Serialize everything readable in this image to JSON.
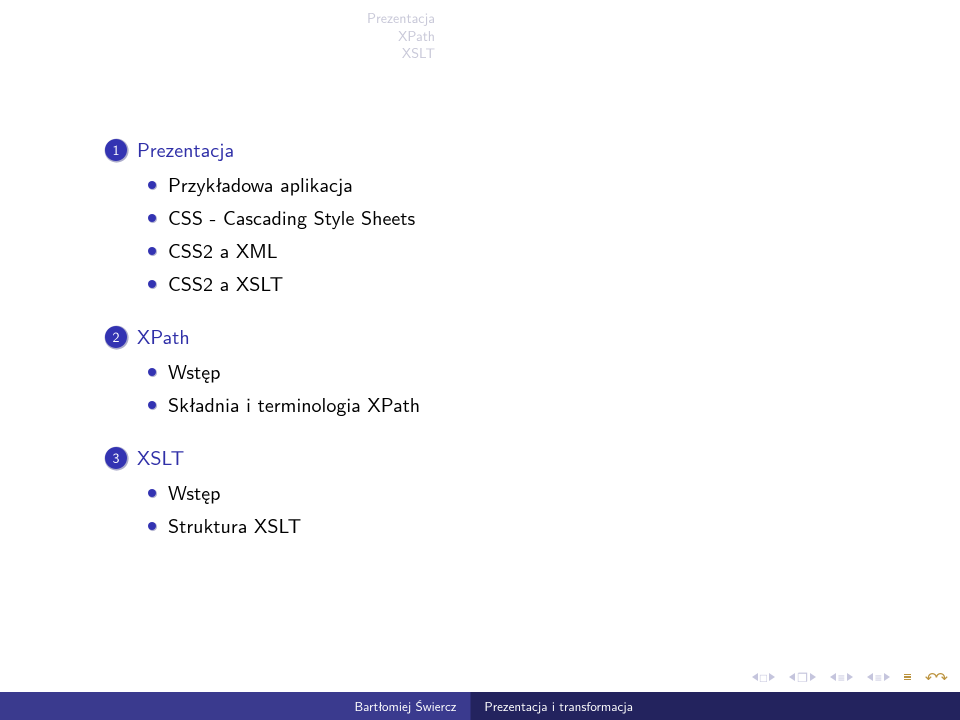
{
  "header": {
    "lines": [
      "Prezentacja",
      "XPath",
      "XSLT"
    ]
  },
  "sections": [
    {
      "num": "1",
      "title": "Prezentacja",
      "items": [
        "Przykładowa aplikacja",
        "CSS - Cascading Style Sheets",
        "CSS2 a XML",
        "CSS2 a XSLT"
      ]
    },
    {
      "num": "2",
      "title": "XPath",
      "items": [
        "Wstęp",
        "Składnia i terminologia XPath"
      ]
    },
    {
      "num": "3",
      "title": "XSLT",
      "items": [
        "Wstęp",
        "Struktura XSLT"
      ]
    }
  ],
  "footer": {
    "author": "Bartłomiej Świercz",
    "title": "Prezentacja i transformacja"
  }
}
